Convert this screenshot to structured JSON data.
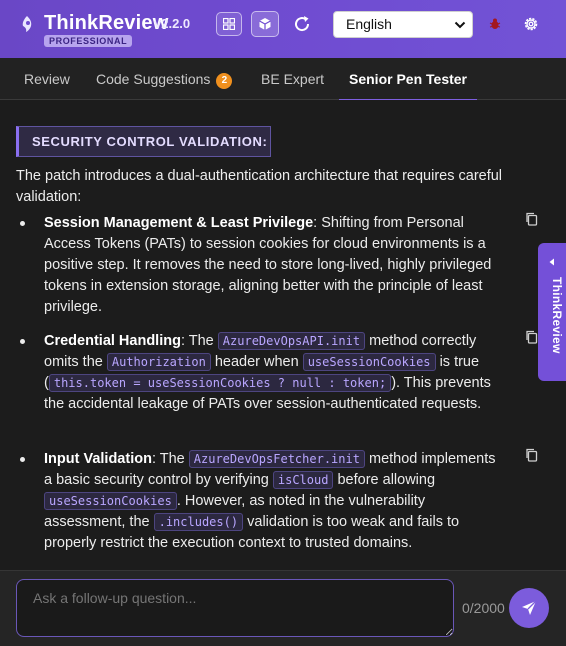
{
  "header": {
    "brand": "ThinkReview",
    "version": "v2.2.0",
    "badge": "PROFESSIONAL",
    "language_selected": "English",
    "icons": [
      "logo-icon",
      "grid-icon",
      "cube-icon",
      "refresh-icon",
      "bug-icon",
      "gear-icon"
    ]
  },
  "tabs": [
    {
      "label": "Review"
    },
    {
      "label": "Code Suggestions",
      "count": "2"
    },
    {
      "label": "BE Expert"
    },
    {
      "label": "Senior Pen Tester",
      "active": true
    }
  ],
  "content": {
    "heading": "SECURITY CONTROL VALIDATION:",
    "intro": "The patch introduces a dual-authentication architecture that requires careful validation:",
    "items": [
      {
        "title": "Session Management & Least Privilege",
        "text": "Shifting from Personal Access Tokens (PATs) to session cookies for cloud environments is a positive step. It removes the need to store long-lived, highly privileged tokens in extension storage, aligning better with the principle of least privilege."
      },
      {
        "title": "Credential Handling",
        "t1": "The",
        "c1": "AzureDevOpsAPI.init",
        "t2": "method correctly omits the",
        "c2": "Authorization",
        "t3": "header when",
        "c3": "useSessionCookies",
        "t4": "is true (",
        "c4": "this.token = useSessionCookies ? null : token;",
        "t5": "). This prevents the accidental leakage of PATs over session-authenticated requests."
      },
      {
        "title": "Input Validation",
        "t1": "The",
        "c1": "AzureDevOpsFetcher.init",
        "t2": "method implements a basic security control by verifying",
        "c2": "isCloud",
        "t3": "before allowing",
        "c3": "useSessionCookies",
        "t4": ". However, as noted in the vulnerability assessment, the",
        "c4": ".includes()",
        "t5": "validation is too weak and fails to properly restrict the execution context to trusted domains."
      }
    ]
  },
  "side_tab": {
    "label": "ThinkReview"
  },
  "footer": {
    "placeholder": "Ask a follow-up question...",
    "char_count": "0/2000"
  },
  "colors": {
    "header_bg": "#6f4bd0",
    "accent": "#7c5cdc",
    "badge_orange": "#f0901e",
    "content_bg": "#1c1c1c"
  }
}
